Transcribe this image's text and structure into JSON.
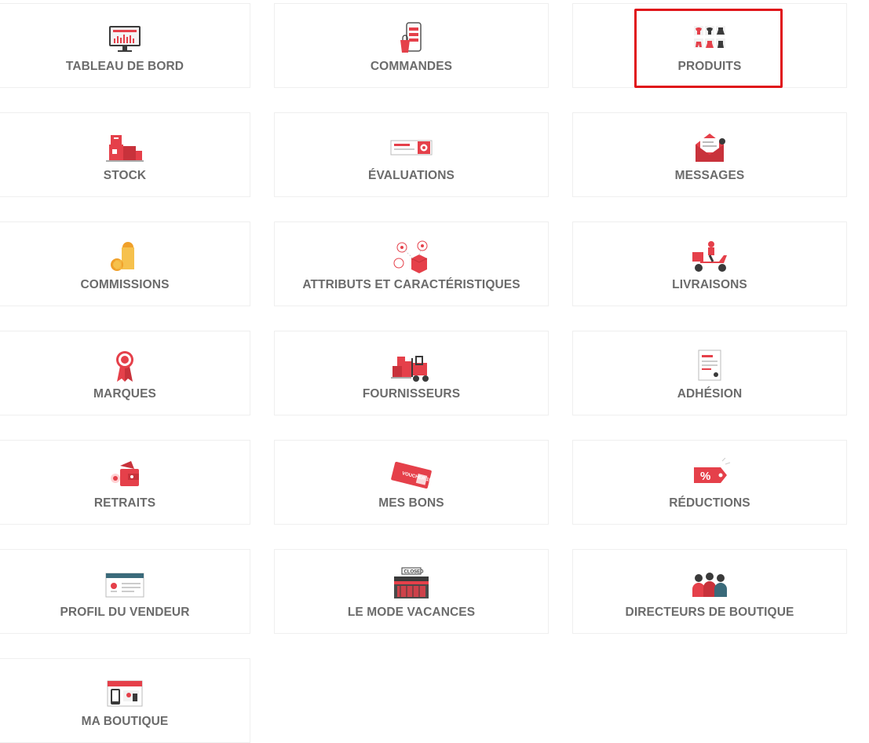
{
  "accent_color": "#e0141a",
  "icon_red": "#e5404a",
  "tiles": [
    {
      "label": "TABLEAU DE BORD",
      "icon": "dashboard-monitor-icon"
    },
    {
      "label": "COMMANDES",
      "icon": "orders-phone-icon"
    },
    {
      "label": "PRODUITS",
      "icon": "products-clothes-icon",
      "selected": true
    },
    {
      "label": "STOCK",
      "icon": "stock-boxes-icon"
    },
    {
      "label": "ÉVALUATIONS",
      "icon": "reviews-rating-icon"
    },
    {
      "label": "MESSAGES",
      "icon": "messages-envelope-icon"
    },
    {
      "label": "COMMISSIONS",
      "icon": "commissions-coins-icon"
    },
    {
      "label": "ATTRIBUTS ET CARACTÉRISTIQUES",
      "icon": "attributes-box-icon"
    },
    {
      "label": "LIVRAISONS",
      "icon": "delivery-scooter-icon"
    },
    {
      "label": "MARQUES",
      "icon": "brands-ribbon-icon"
    },
    {
      "label": "FOURNISSEURS",
      "icon": "suppliers-forklift-icon"
    },
    {
      "label": "ADHÉSION",
      "icon": "membership-document-icon"
    },
    {
      "label": "RETRAITS",
      "icon": "withdrawals-wallet-icon"
    },
    {
      "label": "MES BONS",
      "icon": "vouchers-ticket-icon",
      "icon_text": "VOUCHER 15%"
    },
    {
      "label": "RÉDUCTIONS",
      "icon": "discounts-tag-icon",
      "icon_text": "%"
    },
    {
      "label": "PROFIL DU VENDEUR",
      "icon": "vendor-profile-icon"
    },
    {
      "label": "LE MODE VACANCES",
      "icon": "vacation-store-icon",
      "icon_text": "CLOSED"
    },
    {
      "label": "DIRECTEURS DE BOUTIQUE",
      "icon": "shop-managers-people-icon"
    },
    {
      "label": "MA BOUTIQUE",
      "icon": "my-shop-storefront-icon"
    }
  ]
}
